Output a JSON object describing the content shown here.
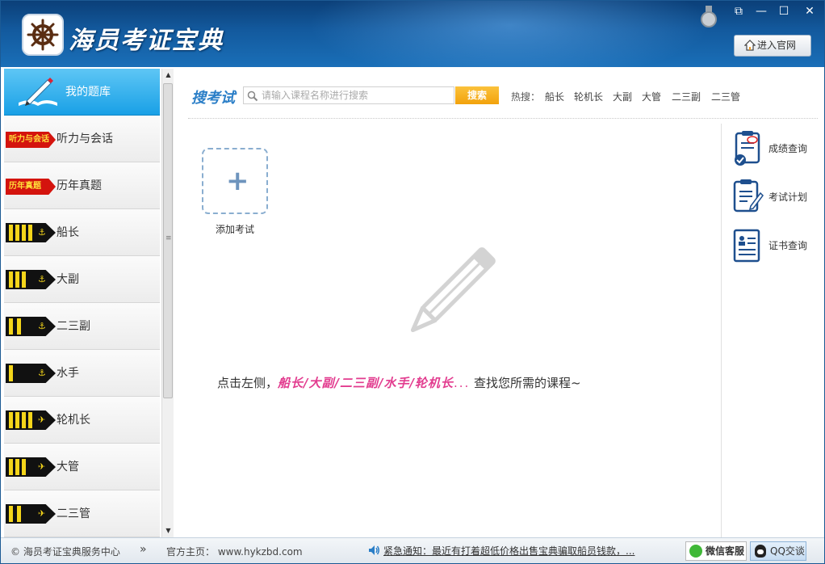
{
  "header": {
    "app_title": "海员考证宝典",
    "site_button": "进入官网",
    "window_controls": {
      "restore": "⧉",
      "minimize": "—",
      "maximize": "☐",
      "close": "✕"
    }
  },
  "sidebar": {
    "header_label": "我的题库",
    "items": [
      {
        "label": "听力与会话",
        "tag": "听力与会话",
        "icon": "red-tag-icon"
      },
      {
        "label": "历年真题",
        "tag": "历年真题",
        "icon": "red-tag-icon"
      },
      {
        "label": "船长",
        "icon": "rank-4-stripes-anchor-icon"
      },
      {
        "label": "大副",
        "icon": "rank-3-stripes-anchor-icon"
      },
      {
        "label": "二三副",
        "icon": "rank-2-stripes-anchor-icon"
      },
      {
        "label": "水手",
        "icon": "rank-1-stripe-anchor-icon"
      },
      {
        "label": "轮机长",
        "icon": "rank-4-stripes-propeller-icon"
      },
      {
        "label": "大管",
        "icon": "rank-3-stripes-propeller-icon"
      },
      {
        "label": "二三管",
        "icon": "rank-2-stripes-propeller-icon"
      }
    ]
  },
  "search": {
    "title": "搜考试",
    "placeholder": "请输入课程名称进行搜索",
    "button": "搜索",
    "hot_label": "热搜：",
    "hot_items": [
      "船长",
      "轮机长",
      "大副",
      "大管",
      "二三副",
      "二三管"
    ]
  },
  "main": {
    "add_exam_label": "添加考试",
    "hint_prefix": "点击左侧，",
    "hint_emphasis": "船长/大副/二三副/水手/轮机长",
    "hint_dots": "...",
    "hint_suffix": "查找您所需的课程~"
  },
  "right_panel": {
    "items": [
      {
        "label": "成绩查询",
        "icon": "score-clipboard-icon"
      },
      {
        "label": "考试计划",
        "icon": "plan-clipboard-icon"
      },
      {
        "label": "证书查询",
        "icon": "certificate-icon"
      }
    ]
  },
  "statusbar": {
    "copyright": "© 海员考证宝典服务中心",
    "chevron": "»",
    "homepage": "官方主页：  www.hykzbd.com",
    "notice": "紧急通知：最近有打着超低价格出售宝典骗取船员钱款，...",
    "wechat": "微信客服",
    "qq": "QQ交谈"
  },
  "colors": {
    "accent": "#1a9fe6",
    "header": "#135a9e",
    "highlight": "#e23c8f",
    "search_button": "#f2a20c"
  }
}
